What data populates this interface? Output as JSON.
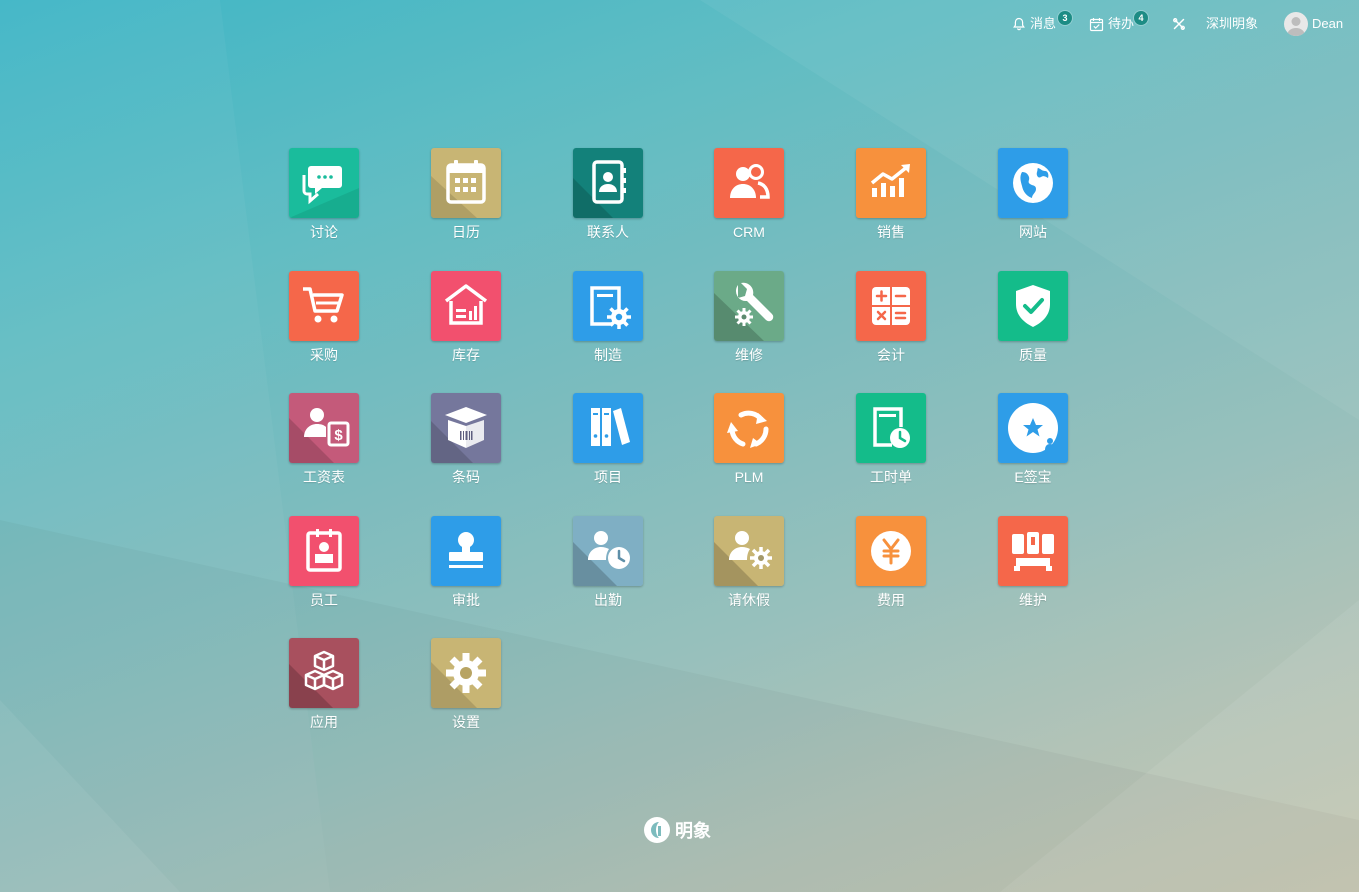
{
  "topbar": {
    "messages_label": "消息",
    "messages_count": "3",
    "todo_label": "待办",
    "todo_count": "4",
    "company": "深圳明象",
    "user_name": "Dean"
  },
  "apps": [
    {
      "label": "讨论",
      "icon": "chat-icon",
      "color": "#1ABC9C"
    },
    {
      "label": "日历",
      "icon": "calendar-icon",
      "color": "#C8B574"
    },
    {
      "label": "联系人",
      "icon": "contacts-icon",
      "color": "#13817A"
    },
    {
      "label": "CRM",
      "icon": "crm-users-icon",
      "color": "#F5674A"
    },
    {
      "label": "销售",
      "icon": "sales-chart-icon",
      "color": "#F7913D"
    },
    {
      "label": "网站",
      "icon": "globe-icon",
      "color": "#2E9DE8"
    },
    {
      "label": "采购",
      "icon": "cart-icon",
      "color": "#F5674A"
    },
    {
      "label": "库存",
      "icon": "warehouse-icon",
      "color": "#F2506E"
    },
    {
      "label": "制造",
      "icon": "manufacturing-icon",
      "color": "#2E9DE8"
    },
    {
      "label": "维修",
      "icon": "wrench-gear-icon",
      "color": "#5C8A6E"
    },
    {
      "label": "会计",
      "icon": "calculator-icon",
      "color": "#F5674A"
    },
    {
      "label": "质量",
      "icon": "shield-check-icon",
      "color": "#14BC8A"
    },
    {
      "label": "工资表",
      "icon": "payroll-icon",
      "color": "#C45A7A"
    },
    {
      "label": "条码",
      "icon": "barcode-box-icon",
      "color": "#5E5F80"
    },
    {
      "label": "项目",
      "icon": "binders-icon",
      "color": "#2E9DE8"
    },
    {
      "label": "PLM",
      "icon": "recycle-icon",
      "color": "#F7913D"
    },
    {
      "label": "工时单",
      "icon": "timesheet-icon",
      "color": "#14BC8A"
    },
    {
      "label": "E签宝",
      "icon": "e-sign-icon",
      "color": "#2E9DE8"
    },
    {
      "label": "员工",
      "icon": "employee-badge-icon",
      "color": "#F2506E"
    },
    {
      "label": "审批",
      "icon": "stamp-icon",
      "color": "#2E9DE8"
    },
    {
      "label": "出勤",
      "icon": "attendance-icon",
      "color": "#5E8FA8"
    },
    {
      "label": "请休假",
      "icon": "leave-icon",
      "color": "#A4996A"
    },
    {
      "label": "费用",
      "icon": "yen-coin-icon",
      "color": "#F7913D"
    },
    {
      "label": "维护",
      "icon": "maintenance-icon",
      "color": "#F5674A"
    },
    {
      "label": "应用",
      "icon": "cubes-icon",
      "color": "#8E3F4D"
    },
    {
      "label": "设置",
      "icon": "settings-gear-icon",
      "color": "#C8B574"
    }
  ],
  "footer": {
    "brand": "明象"
  }
}
